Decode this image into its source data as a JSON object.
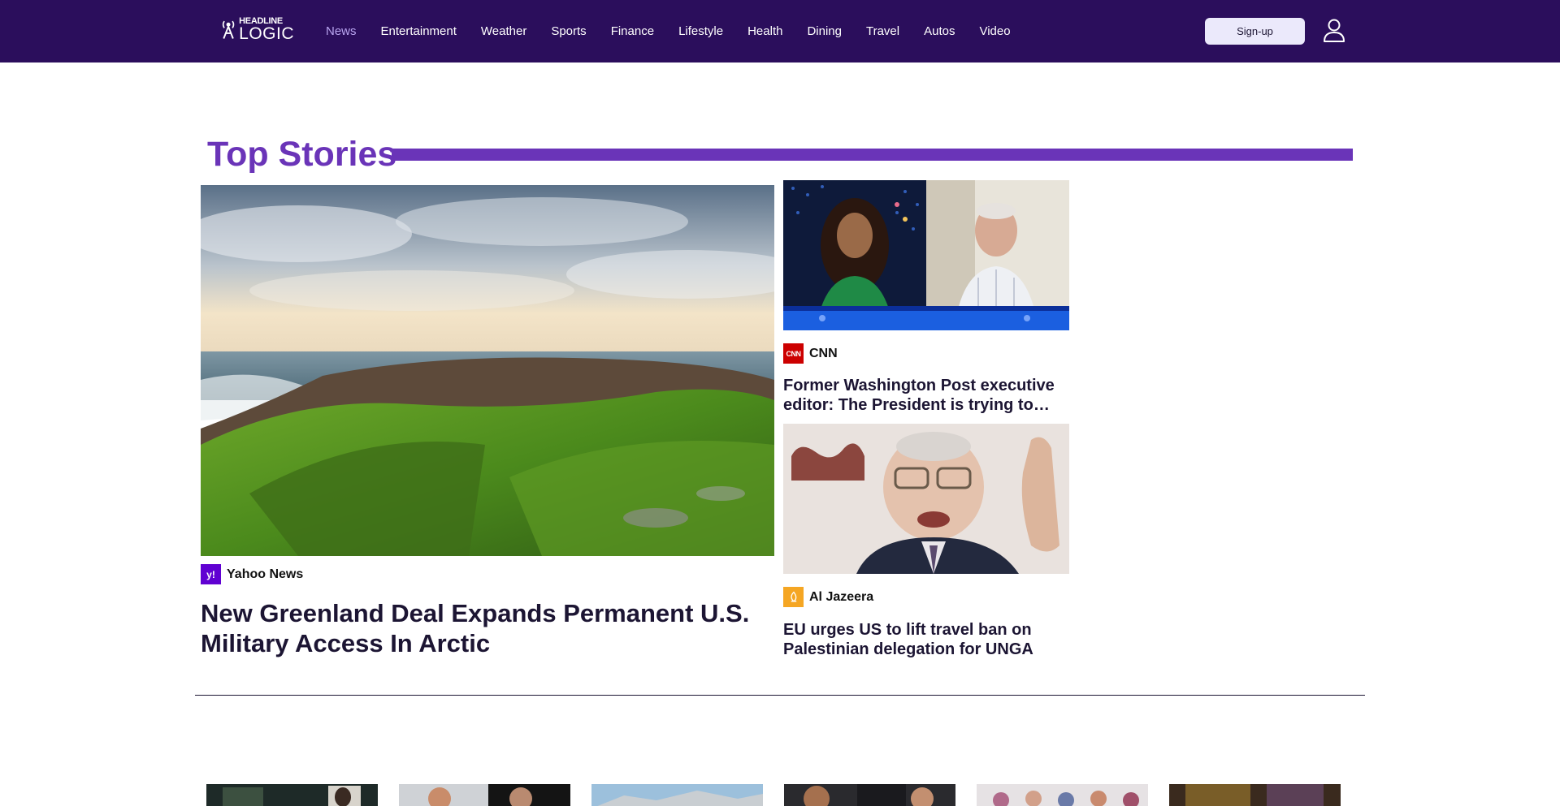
{
  "header": {
    "logo": {
      "line1": "HEADLINE",
      "line2": "LOGIC"
    },
    "nav": [
      {
        "label": "News",
        "active": true
      },
      {
        "label": "Entertainment"
      },
      {
        "label": "Weather"
      },
      {
        "label": "Sports"
      },
      {
        "label": "Finance"
      },
      {
        "label": "Lifestyle"
      },
      {
        "label": "Health"
      },
      {
        "label": "Dining"
      },
      {
        "label": "Travel"
      },
      {
        "label": "Autos"
      },
      {
        "label": "Video"
      }
    ],
    "signup_label": "Sign-up",
    "user_icon": "user-icon"
  },
  "top_stories": {
    "title": "Top Stories",
    "accent_color": "#6a34b8",
    "main": {
      "source": "Yahoo News",
      "source_badge": "y!",
      "source_color": "#6001d2",
      "headline": "New Greenland Deal Expands Permanent U.S. Military Access In Arctic"
    },
    "side": [
      {
        "source": "CNN",
        "source_badge": "CNN",
        "source_color": "#cc0000",
        "headline": "Former Washington Post executive editor: The President is trying to intimidate the press"
      },
      {
        "source": "Al Jazeera",
        "source_badge": "aljazeera-logo-icon",
        "source_color": "#f5a623",
        "headline": "EU urges US to lift travel ban on Palestinian delegation for UNGA"
      }
    ]
  },
  "colors": {
    "header_bg": "#2b0e5c",
    "nav_active": "#b9a5f0",
    "signup_bg": "#ebe9fb"
  }
}
